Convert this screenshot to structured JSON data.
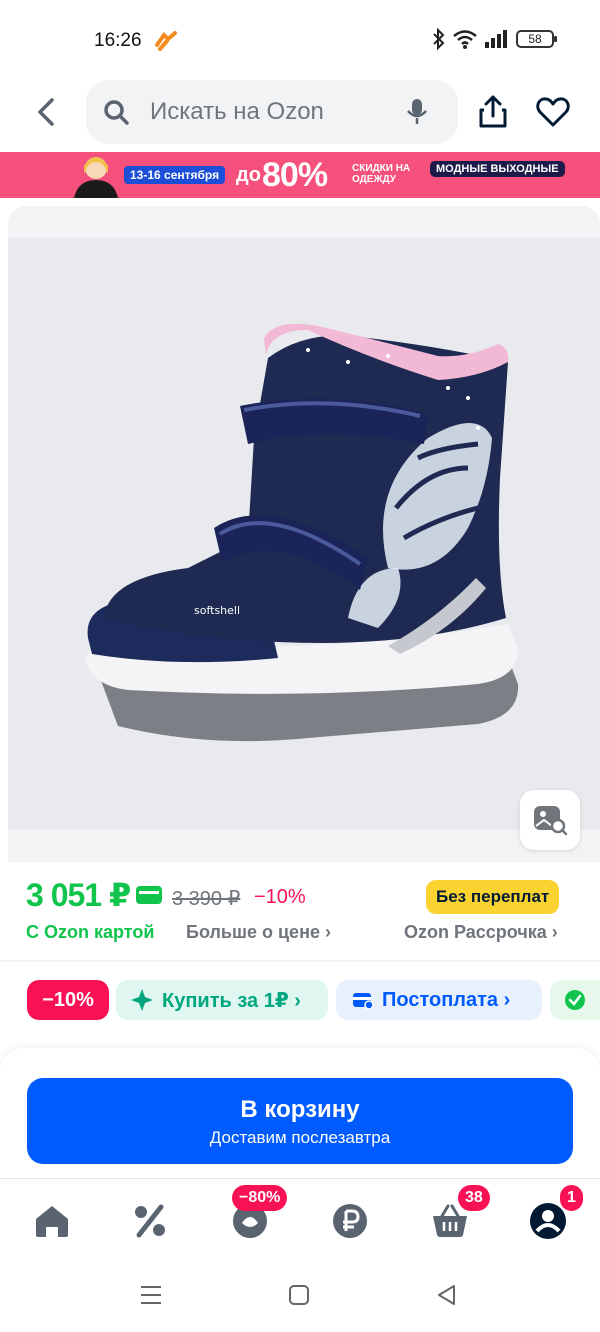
{
  "status_bar": {
    "time": "16:26",
    "battery": "58"
  },
  "header": {
    "search_placeholder": "Искать на Ozon"
  },
  "promo": {
    "dates": "13-16 сентября",
    "prefix": "до",
    "percent": "80%",
    "sale_text": "СКИДКИ НА ОДЕЖДУ",
    "weekend_text": "МОДНЫЕ ВЫХОДНЫЕ"
  },
  "price": {
    "current": "3 051 ₽",
    "old": "3 390 ₽",
    "discount": "−10%",
    "badge": "Без переплат",
    "with_card": "С Ozon картой",
    "more_price": "Больше о цене ›",
    "installment": "Ozon Рассрочка ›"
  },
  "chips": {
    "discount": "−10%",
    "buy_for": "Купить за 1₽ ›",
    "postpay": "Постоплата ›"
  },
  "cart": {
    "title": "В корзину",
    "subtitle": "Доставим послезавтра"
  },
  "bottom_nav": {
    "fresh_badge": "−80%",
    "cart_badge": "38",
    "profile_badge": "1"
  },
  "colors": {
    "ozon_blue": "#005bff",
    "green_price": "#10c44c",
    "pink_accent": "#f91155",
    "promo_bg": "#f5517c",
    "yellow_badge": "#fbd331"
  }
}
